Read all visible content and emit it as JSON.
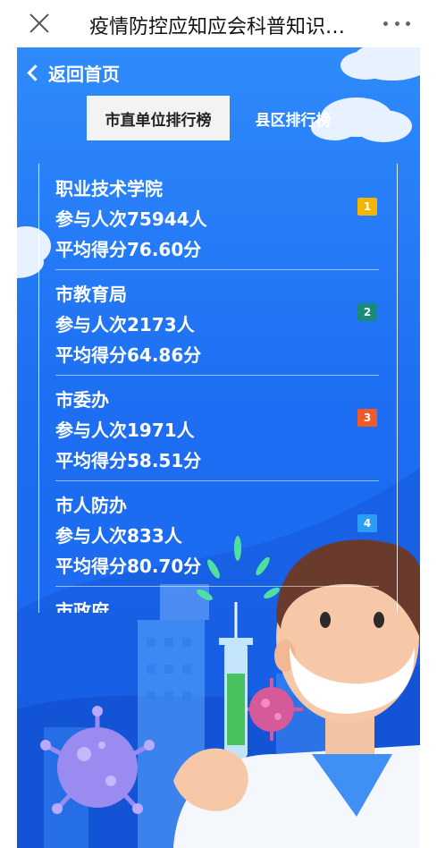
{
  "nav": {
    "title": "疫情防控应知应会科普知识…"
  },
  "header": {
    "back_label": "返回首页"
  },
  "tabs": [
    {
      "label": "市直单位排行榜",
      "active": true
    },
    {
      "label": "县区排行榜",
      "active": false
    }
  ],
  "rankings": [
    {
      "name": "职业技术学院",
      "participants": "参与人次75944人",
      "average": "平均得分76.60分",
      "rank": "1",
      "color": "#f4b400"
    },
    {
      "name": "市教育局",
      "participants": "参与人次2173人",
      "average": "平均得分64.86分",
      "rank": "2",
      "color": "#1a8a7a"
    },
    {
      "name": "市委办",
      "participants": "参与人次1971人",
      "average": "平均得分58.51分",
      "rank": "3",
      "color": "#f05a28"
    },
    {
      "name": "市人防办",
      "participants": "参与人次833人",
      "average": "平均得分80.70分",
      "rank": "4",
      "color": "#2a9df4"
    },
    {
      "name": "市政府",
      "participants": "",
      "average": "",
      "rank": "",
      "color": ""
    }
  ],
  "colors": {
    "background": "#1d6ef2",
    "nav_bg": "#ffffff"
  },
  "icons": [
    "close-icon",
    "more-icon",
    "chevron-left-icon"
  ]
}
